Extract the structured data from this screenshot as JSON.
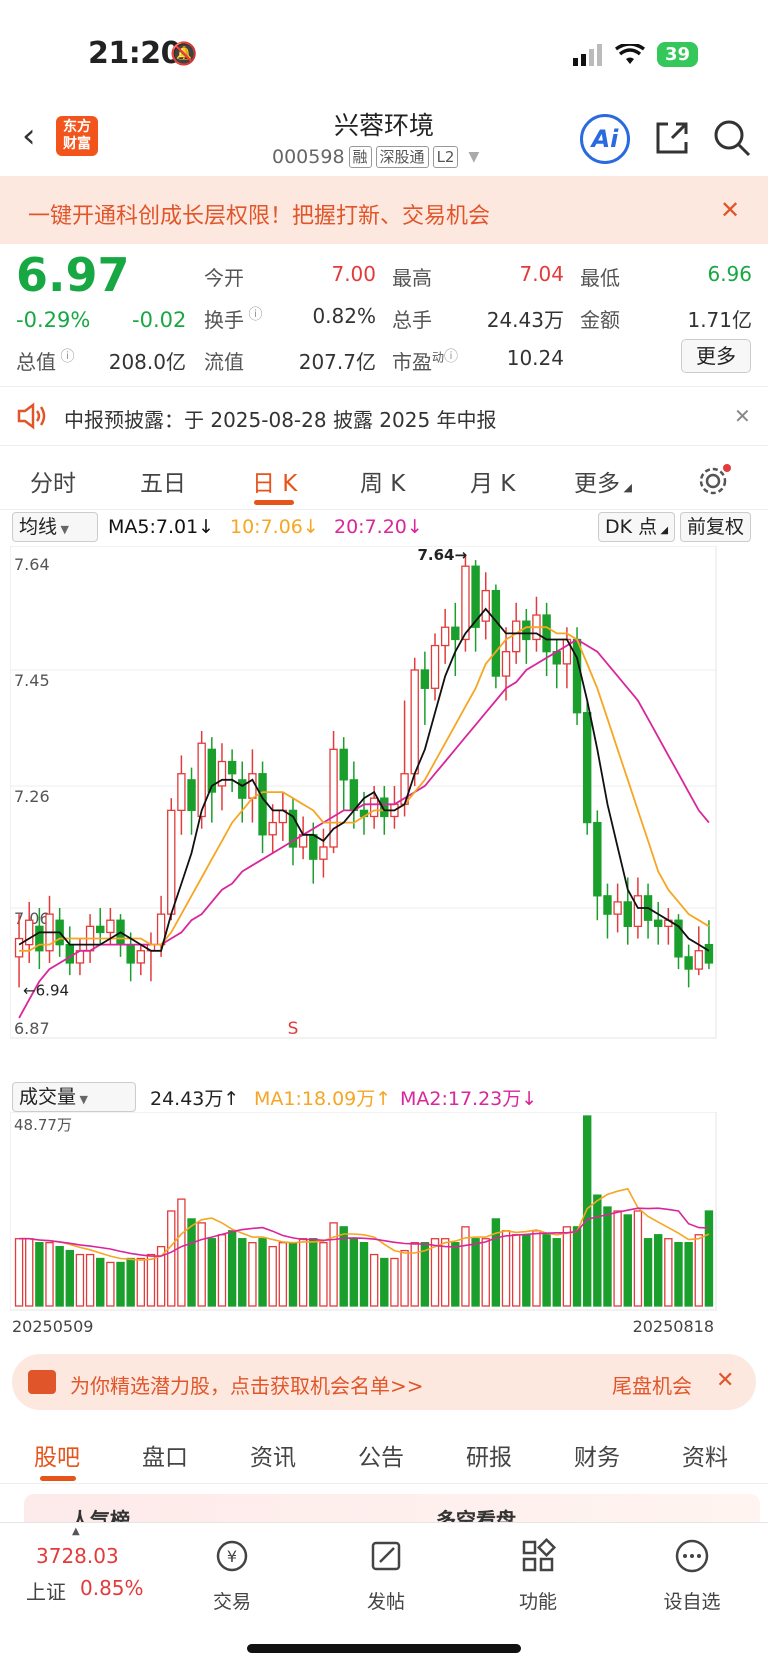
{
  "status": {
    "time": "21:20",
    "battery": "39"
  },
  "header": {
    "title": "兴蓉环境",
    "code": "000598",
    "tags": [
      "融",
      "深股通",
      "L2"
    ],
    "logo": "东方\n财富",
    "logo_l1": "东方",
    "logo_l2": "财富",
    "ai": "Ai"
  },
  "banner": {
    "text": "一键开通科创成长层权限！把握打新、交易机会"
  },
  "quote": {
    "price": "6.97",
    "change_pct": "-0.29%",
    "change": "-0.02",
    "open_label": "今开",
    "open": "7.00",
    "high_label": "最高",
    "high": "7.04",
    "low_label": "最低",
    "low": "6.96",
    "turnover_label": "换手",
    "turnover": "0.82%",
    "volume_label": "总手",
    "volume": "24.43万",
    "amount_label": "金额",
    "amount": "1.71亿",
    "mktcap_label": "总值",
    "mktcap": "208.0亿",
    "float_label": "流值",
    "float": "207.7亿",
    "pe_label": "市盈",
    "pe_sup": "动",
    "pe": "10.24",
    "more": "更多"
  },
  "notice": {
    "text": "中报预披露：于 2025-08-28 披露 2025 年中报"
  },
  "tabs": [
    "分时",
    "五日",
    "日 K",
    "周 K",
    "月 K",
    "更多"
  ],
  "active_tab": "日 K",
  "kline": {
    "indicator_select": "均线",
    "ma5": "MA5:7.01↓",
    "ma10": "10:7.06↓",
    "ma20": "20:7.20↓",
    "dk": "DK 点",
    "adjust": "前复权",
    "y_labels": [
      "7.64",
      "7.45",
      "7.26",
      "7.06",
      "6.87"
    ],
    "high_mark": "7.64",
    "low_mark": "6.94",
    "s_mark": "S",
    "colors": {
      "up": "#e33b3b",
      "down": "#1a9e2c",
      "ma5": "#111111",
      "ma10": "#f5a623",
      "ma20": "#d9269b"
    }
  },
  "volume": {
    "select": "成交量",
    "value": "24.43万↑",
    "ma1": "MA1:18.09万↑",
    "ma2": "MA2:17.23万↓",
    "max_label": "48.77万",
    "start_date": "20250509",
    "end_date": "20250818"
  },
  "chart_data": {
    "type": "candlestick",
    "ylim": [
      6.87,
      7.64
    ],
    "candles": [
      [
        6.98,
        7.01,
        6.93,
        7.05
      ],
      [
        7.0,
        7.04,
        6.97,
        7.07
      ],
      [
        7.03,
        6.99,
        6.96,
        7.06
      ],
      [
        6.99,
        7.05,
        6.97,
        7.08
      ],
      [
        7.04,
        7.0,
        6.98,
        7.06
      ],
      [
        7.0,
        6.97,
        6.95,
        7.03
      ],
      [
        6.97,
        6.99,
        6.95,
        7.01
      ],
      [
        6.99,
        7.03,
        6.97,
        7.05
      ],
      [
        7.03,
        7.02,
        7.0,
        7.06
      ],
      [
        7.02,
        7.04,
        7.0,
        7.06
      ],
      [
        7.04,
        7.0,
        6.98,
        7.05
      ],
      [
        7.0,
        6.97,
        6.94,
        7.02
      ],
      [
        6.97,
        6.99,
        6.95,
        7.0
      ],
      [
        6.99,
        7.0,
        6.94,
        7.02
      ],
      [
        7.0,
        7.05,
        6.98,
        7.08
      ],
      [
        7.05,
        7.22,
        7.04,
        7.24
      ],
      [
        7.22,
        7.28,
        7.18,
        7.31
      ],
      [
        7.27,
        7.22,
        7.18,
        7.29
      ],
      [
        7.21,
        7.33,
        7.19,
        7.35
      ],
      [
        7.32,
        7.25,
        7.2,
        7.34
      ],
      [
        7.26,
        7.3,
        7.22,
        7.33
      ],
      [
        7.3,
        7.28,
        7.25,
        7.32
      ],
      [
        7.27,
        7.24,
        7.2,
        7.3
      ],
      [
        7.24,
        7.28,
        7.2,
        7.32
      ],
      [
        7.28,
        7.18,
        7.15,
        7.3
      ],
      [
        7.18,
        7.2,
        7.15,
        7.23
      ],
      [
        7.2,
        7.22,
        7.17,
        7.25
      ],
      [
        7.22,
        7.16,
        7.13,
        7.24
      ],
      [
        7.16,
        7.18,
        7.14,
        7.21
      ],
      [
        7.18,
        7.14,
        7.1,
        7.2
      ],
      [
        7.14,
        7.16,
        7.11,
        7.19
      ],
      [
        7.16,
        7.32,
        7.15,
        7.35
      ],
      [
        7.32,
        7.27,
        7.22,
        7.34
      ],
      [
        7.27,
        7.22,
        7.19,
        7.3
      ],
      [
        7.22,
        7.21,
        7.18,
        7.25
      ],
      [
        7.21,
        7.24,
        7.19,
        7.26
      ],
      [
        7.24,
        7.21,
        7.18,
        7.26
      ],
      [
        7.21,
        7.23,
        7.19,
        7.26
      ],
      [
        7.23,
        7.28,
        7.21,
        7.4
      ],
      [
        7.28,
        7.45,
        7.26,
        7.47
      ],
      [
        7.45,
        7.42,
        7.36,
        7.48
      ],
      [
        7.42,
        7.49,
        7.4,
        7.51
      ],
      [
        7.49,
        7.52,
        7.46,
        7.55
      ],
      [
        7.52,
        7.5,
        7.44,
        7.56
      ],
      [
        7.5,
        7.62,
        7.48,
        7.64
      ],
      [
        7.62,
        7.52,
        7.48,
        7.63
      ],
      [
        7.53,
        7.58,
        7.5,
        7.61
      ],
      [
        7.58,
        7.44,
        7.42,
        7.59
      ],
      [
        7.44,
        7.48,
        7.4,
        7.52
      ],
      [
        7.48,
        7.53,
        7.46,
        7.56
      ],
      [
        7.53,
        7.5,
        7.46,
        7.55
      ],
      [
        7.5,
        7.54,
        7.48,
        7.57
      ],
      [
        7.54,
        7.48,
        7.44,
        7.56
      ],
      [
        7.48,
        7.46,
        7.42,
        7.5
      ],
      [
        7.46,
        7.5,
        7.42,
        7.52
      ],
      [
        7.5,
        7.38,
        7.36,
        7.52
      ],
      [
        7.38,
        7.2,
        7.18,
        7.4
      ],
      [
        7.2,
        7.08,
        7.04,
        7.22
      ],
      [
        7.08,
        7.05,
        7.01,
        7.1
      ],
      [
        7.05,
        7.07,
        7.02,
        7.1
      ],
      [
        7.07,
        7.03,
        7.0,
        7.11
      ],
      [
        7.03,
        7.08,
        7.01,
        7.11
      ],
      [
        7.08,
        7.04,
        7.01,
        7.1
      ],
      [
        7.04,
        7.03,
        7.0,
        7.07
      ],
      [
        7.03,
        7.04,
        7.0,
        7.06
      ],
      [
        7.04,
        6.98,
        6.96,
        7.05
      ],
      [
        6.98,
        6.96,
        6.93,
        7.0
      ],
      [
        6.96,
        6.99,
        6.95,
        7.03
      ],
      [
        7.0,
        6.97,
        6.96,
        7.04
      ]
    ],
    "ma5": [
      7.0,
      7.01,
      7.02,
      7.02,
      7.02,
      7.0,
      7.0,
      7.0,
      7.0,
      7.01,
      7.02,
      7.01,
      7.0,
      6.99,
      6.99,
      7.05,
      7.1,
      7.15,
      7.22,
      7.26,
      7.27,
      7.27,
      7.26,
      7.27,
      7.24,
      7.22,
      7.22,
      7.21,
      7.18,
      7.18,
      7.17,
      7.19,
      7.2,
      7.22,
      7.24,
      7.25,
      7.22,
      7.22,
      7.23,
      7.28,
      7.32,
      7.38,
      7.44,
      7.48,
      7.51,
      7.53,
      7.55,
      7.53,
      7.51,
      7.51,
      7.51,
      7.51,
      7.5,
      7.5,
      7.5,
      7.47,
      7.4,
      7.32,
      7.23,
      7.16,
      7.09,
      7.06,
      7.06,
      7.05,
      7.04,
      7.03,
      7.01,
      7.0,
      6.99
    ],
    "ma10": [
      6.99,
      6.99,
      7.0,
      7.0,
      7.01,
      7.01,
      7.01,
      7.01,
      7.01,
      7.01,
      7.01,
      7.01,
      7.01,
      7.0,
      7.0,
      7.02,
      7.05,
      7.08,
      7.11,
      7.14,
      7.17,
      7.2,
      7.22,
      7.24,
      7.25,
      7.25,
      7.25,
      7.24,
      7.23,
      7.22,
      7.2,
      7.2,
      7.2,
      7.2,
      7.21,
      7.22,
      7.22,
      7.22,
      7.23,
      7.25,
      7.27,
      7.3,
      7.33,
      7.36,
      7.39,
      7.42,
      7.46,
      7.48,
      7.5,
      7.51,
      7.52,
      7.52,
      7.52,
      7.51,
      7.51,
      7.5,
      7.46,
      7.42,
      7.37,
      7.32,
      7.27,
      7.22,
      7.17,
      7.12,
      7.09,
      7.07,
      7.05,
      7.04,
      7.03
    ],
    "ma20": [
      6.88,
      6.91,
      6.94,
      6.96,
      6.97,
      6.98,
      6.99,
      6.99,
      7.0,
      7.0,
      7.0,
      7.0,
      7.0,
      7.0,
      7.0,
      7.01,
      7.02,
      7.04,
      7.05,
      7.07,
      7.09,
      7.1,
      7.12,
      7.13,
      7.14,
      7.15,
      7.16,
      7.17,
      7.18,
      7.19,
      7.2,
      7.21,
      7.22,
      7.22,
      7.23,
      7.23,
      7.23,
      7.23,
      7.24,
      7.25,
      7.26,
      7.28,
      7.3,
      7.32,
      7.34,
      7.36,
      7.38,
      7.4,
      7.42,
      7.43,
      7.45,
      7.46,
      7.47,
      7.48,
      7.49,
      7.5,
      7.49,
      7.48,
      7.46,
      7.44,
      7.42,
      7.4,
      7.37,
      7.34,
      7.31,
      7.28,
      7.25,
      7.22,
      7.2
    ],
    "volumes": [
      17,
      17,
      16,
      16,
      15,
      14,
      13,
      13,
      12,
      11,
      11,
      12,
      12,
      13,
      15,
      24,
      27,
      22,
      21,
      17,
      18,
      19,
      17,
      16,
      17,
      15,
      16,
      16,
      17,
      17,
      16,
      21,
      20,
      17,
      16,
      13,
      12,
      12,
      14,
      16,
      16,
      17,
      17,
      16,
      20,
      17,
      17,
      22,
      19,
      18,
      18,
      19,
      18,
      17,
      20,
      20,
      48,
      28,
      25,
      24,
      23,
      24,
      17,
      18,
      17,
      16,
      16,
      18,
      24
    ]
  },
  "promo": {
    "text": "为你精选潜力股，点击获取机会名单>>",
    "right": "尾盘机会"
  },
  "tabs2": [
    "股吧",
    "盘口",
    "资讯",
    "公告",
    "研报",
    "财务",
    "资料"
  ],
  "peek": {
    "left": "人气榜",
    "right": "多空看盘"
  },
  "bottom": {
    "index_value": "3728.03",
    "index_name": "上证",
    "index_pct": "0.85%",
    "items": [
      "交易",
      "发帖",
      "功能",
      "设自选"
    ]
  }
}
